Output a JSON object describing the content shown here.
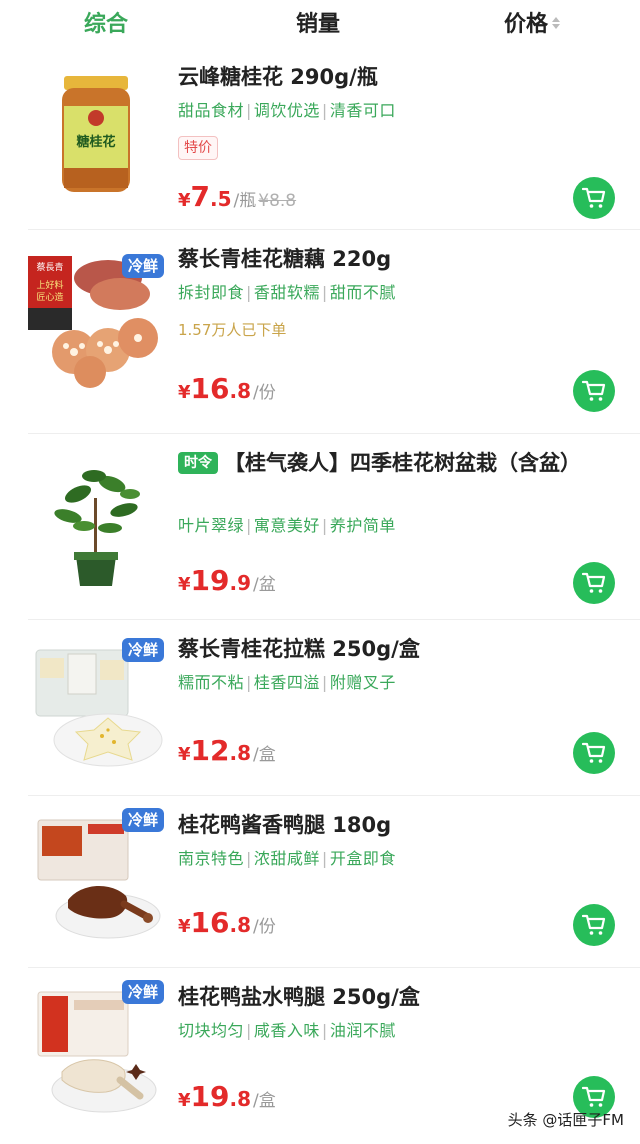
{
  "sort_tabs": [
    {
      "label": "综合"
    },
    {
      "label": "销量"
    },
    {
      "label": "价格"
    }
  ],
  "accent_color": "#3aa85a",
  "cart_color": "#27bd5a",
  "price_color": "#e32a2a",
  "cold_badge_color": "#3a78d8",
  "products": [
    {
      "title": "云峰糖桂花 290g/瓶",
      "tags": [
        "甜品食材",
        "调饮优选",
        "清香可口"
      ],
      "promo": "特价",
      "price_int": "¥7.",
      "price_yen": "¥",
      "price_main": "7",
      "price_dec": ".5",
      "unit": "/瓶",
      "original_price": "¥8.8",
      "image_icon": "osmanthus-jar-image",
      "jar_label": "糖桂花"
    },
    {
      "badge": "冷鲜",
      "title": "蔡长青桂花糖藕 220g",
      "tags": [
        "拆封即食",
        "香甜软糯",
        "甜而不腻"
      ],
      "sold": "1.57万人已下单",
      "price_yen": "¥",
      "price_main": "16",
      "price_dec": ".8",
      "unit": "/份",
      "image_icon": "lotus-root-image",
      "box_label_1": "蔡長青",
      "box_label_2": "上好料",
      "box_label_3": "匠心造"
    },
    {
      "season_tag": "时令",
      "title": "【桂气袭人】四季桂花树盆栽（含盆）",
      "tags": [
        "叶片翠绿",
        "寓意美好",
        "养护简单"
      ],
      "price_yen": "¥",
      "price_main": "19",
      "price_dec": ".9",
      "unit": "/盆",
      "image_icon": "potted-plant-image"
    },
    {
      "badge": "冷鲜",
      "title": "蔡长青桂花拉糕 250g/盒",
      "tags": [
        "糯而不粘",
        "桂香四溢",
        "附赠叉子"
      ],
      "price_yen": "¥",
      "price_main": "12",
      "price_dec": ".8",
      "unit": "/盒",
      "image_icon": "rice-cake-image"
    },
    {
      "badge": "冷鲜",
      "title": "桂花鸭酱香鸭腿 180g",
      "tags": [
        "南京特色",
        "浓甜咸鲜",
        "开盒即食"
      ],
      "price_yen": "¥",
      "price_main": "16",
      "price_dec": ".8",
      "unit": "/份",
      "image_icon": "braised-duck-leg-image"
    },
    {
      "badge": "冷鲜",
      "title": "桂花鸭盐水鸭腿 250g/盒",
      "tags": [
        "切块均匀",
        "咸香入味",
        "油润不腻"
      ],
      "price_yen": "¥",
      "price_main": "19",
      "price_dec": ".8",
      "unit": "/盒",
      "image_icon": "salted-duck-leg-image"
    }
  ],
  "watermark": "头条 @话匣子FM"
}
